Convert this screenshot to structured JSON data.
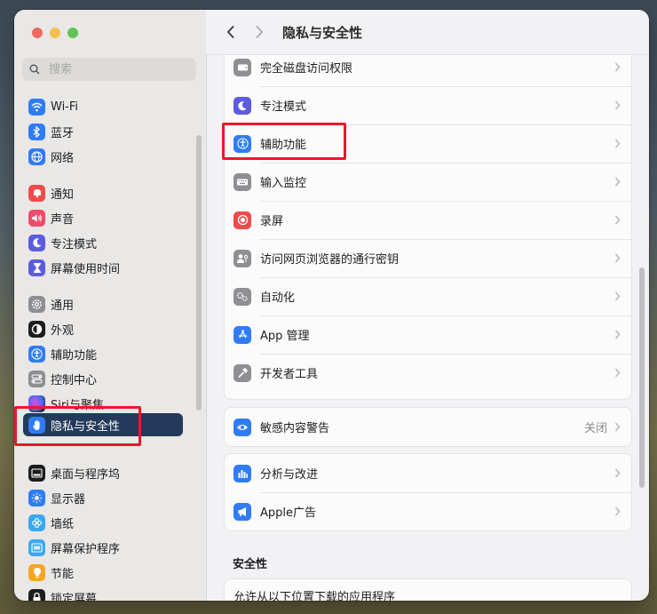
{
  "window": {
    "title": "隐私与安全性"
  },
  "sidebar": {
    "search_placeholder": "搜索",
    "items": [
      {
        "label": "Wi-Fi",
        "icon": "wifi-icon",
        "color": "#2f7cf6"
      },
      {
        "label": "蓝牙",
        "icon": "bluetooth-icon",
        "color": "#2f7cf6"
      },
      {
        "label": "网络",
        "icon": "globe-icon",
        "color": "#2f7cf6"
      },
      {
        "label": "通知",
        "icon": "bell-icon",
        "color": "#ef4b4b"
      },
      {
        "label": "声音",
        "icon": "speaker-icon",
        "color": "#ef4b6a"
      },
      {
        "label": "专注模式",
        "icon": "moon-icon",
        "color": "#5d5ce0"
      },
      {
        "label": "屏幕使用时间",
        "icon": "hourglass-icon",
        "color": "#5d5ce0"
      },
      {
        "label": "通用",
        "icon": "gear-icon",
        "color": "#8e8e93"
      },
      {
        "label": "外观",
        "icon": "appearance-icon",
        "color": "#1d1d1f"
      },
      {
        "label": "辅助功能",
        "icon": "accessibility-icon",
        "color": "#2f7cf6"
      },
      {
        "label": "控制中心",
        "icon": "control-center-icon",
        "color": "#8e8e93"
      },
      {
        "label": "Siri与聚焦",
        "icon": "siri-icon",
        "color": "#2b2b3a"
      },
      {
        "label": "隐私与安全性",
        "icon": "hand-icon",
        "color": "#2f7cf6"
      },
      {
        "label": "桌面与程序坞",
        "icon": "dock-icon",
        "color": "#1d1d1f"
      },
      {
        "label": "显示器",
        "icon": "display-icon",
        "color": "#2f7cf6"
      },
      {
        "label": "墙纸",
        "icon": "wallpaper-icon",
        "color": "#3aa9f0"
      },
      {
        "label": "屏幕保护程序",
        "icon": "screensaver-icon",
        "color": "#3aa9f0"
      },
      {
        "label": "节能",
        "icon": "bulb-icon",
        "color": "#f5a623"
      },
      {
        "label": "锁定屏幕",
        "icon": "lock-icon",
        "color": "#1d1d1f"
      }
    ]
  },
  "main": {
    "group1": [
      {
        "label": "完全磁盘访问权限",
        "icon": "disk-icon",
        "color": "#8e8e93"
      },
      {
        "label": "专注模式",
        "icon": "moon-icon",
        "color": "#5d5ce0"
      },
      {
        "label": "辅助功能",
        "icon": "accessibility-icon",
        "color": "#2f7cf6"
      },
      {
        "label": "输入监控",
        "icon": "keyboard-icon",
        "color": "#8e8e93"
      },
      {
        "label": "录屏",
        "icon": "record-icon",
        "color": "#ef4b4b"
      },
      {
        "label": "访问网页浏览器的通行密钥",
        "icon": "passkey-icon",
        "color": "#8e8e93"
      },
      {
        "label": "自动化",
        "icon": "automation-icon",
        "color": "#8e8e93"
      },
      {
        "label": "App 管理",
        "icon": "appstore-icon",
        "color": "#2f7cf6"
      },
      {
        "label": "开发者工具",
        "icon": "hammer-icon",
        "color": "#8e8e93"
      }
    ],
    "sensitive": {
      "label": "敏感内容警告",
      "value": "关闭",
      "icon": "eye-icon",
      "color": "#2f7cf6"
    },
    "group3": [
      {
        "label": "分析与改进",
        "icon": "chart-icon",
        "color": "#2f7cf6"
      },
      {
        "label": "Apple广告",
        "icon": "megaphone-icon",
        "color": "#2f7cf6"
      }
    ],
    "security": {
      "title": "安全性",
      "allow_label": "允许从以下位置下载的应用程序"
    }
  }
}
